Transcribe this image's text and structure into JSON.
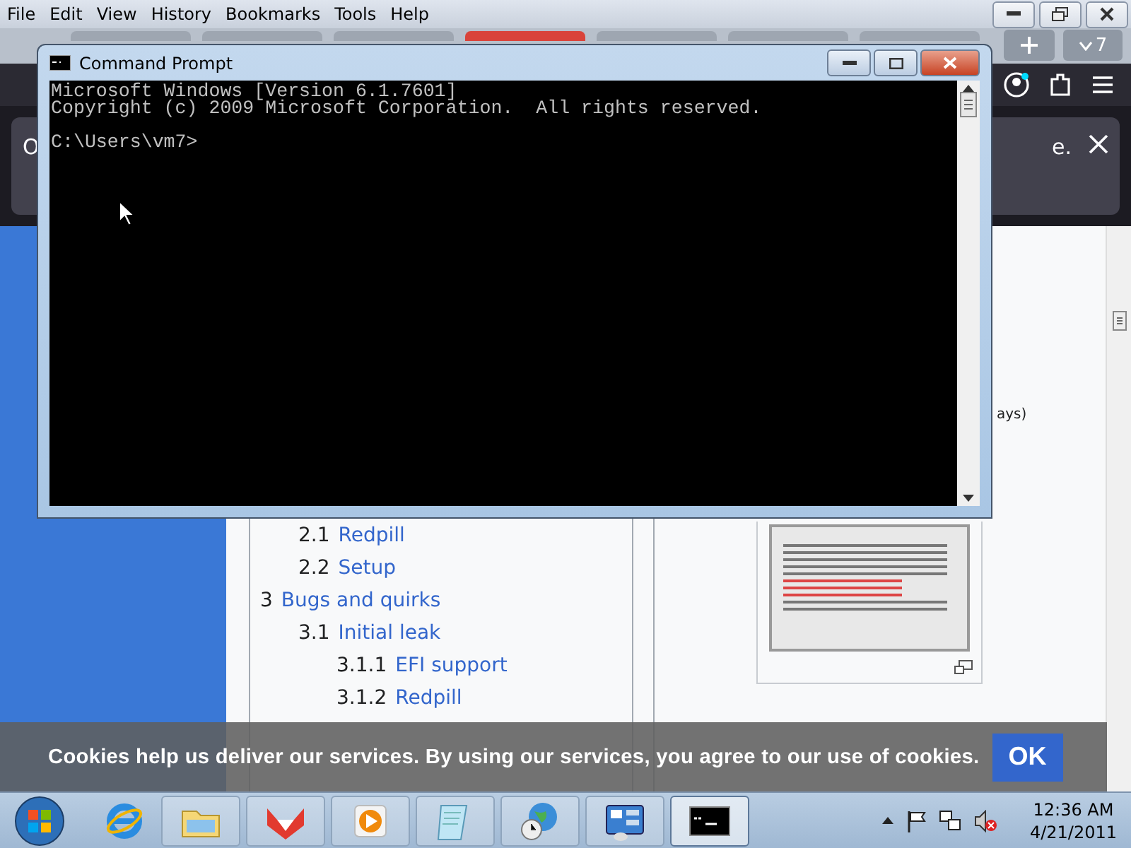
{
  "browser": {
    "menu": [
      "File",
      "Edit",
      "View",
      "History",
      "Bookmarks",
      "Tools",
      "Help"
    ],
    "tabs": [
      {
        "selected": false
      },
      {
        "selected": false
      },
      {
        "selected": false
      },
      {
        "selected": true
      },
      {
        "selected": false
      },
      {
        "selected": false
      },
      {
        "selected": false
      }
    ],
    "tab_count": "7",
    "notification": {
      "text_start": "O",
      "text_end": "e."
    },
    "side_text": "ays)",
    "toc": [
      {
        "children": [
          {
            "number": "2.1",
            "title": "Redpill"
          },
          {
            "number": "2.2",
            "title": "Setup"
          }
        ]
      },
      {
        "number": "3",
        "title": "Bugs and quirks",
        "children": [
          {
            "number": "3.1",
            "title": "Initial leak",
            "children": [
              {
                "number": "3.1.1",
                "title": "EFI support"
              },
              {
                "number": "3.1.2",
                "title": "Redpill"
              }
            ]
          }
        ]
      }
    ]
  },
  "cookie_bar": {
    "text": "Cookies help us deliver our services. By using our services, you agree to our use of cookies.",
    "button": "OK"
  },
  "command_prompt": {
    "title": "Command Prompt",
    "output": [
      "Microsoft Windows [Version 6.1.7601]",
      "Copyright (c) 2009 Microsoft Corporation.  All rights reserved."
    ],
    "prompt": "C:\\Users\\vm7>"
  },
  "taskbar": {
    "items": [
      {
        "kind": "folder",
        "active": false
      },
      {
        "kind": "fox",
        "active": false
      },
      {
        "kind": "media",
        "active": false
      },
      {
        "kind": "notepad",
        "active": false
      },
      {
        "kind": "globe",
        "active": false
      },
      {
        "kind": "panel",
        "active": false
      },
      {
        "kind": "console",
        "active": true
      }
    ],
    "time": "12:36 AM",
    "date": "4/21/2011"
  }
}
